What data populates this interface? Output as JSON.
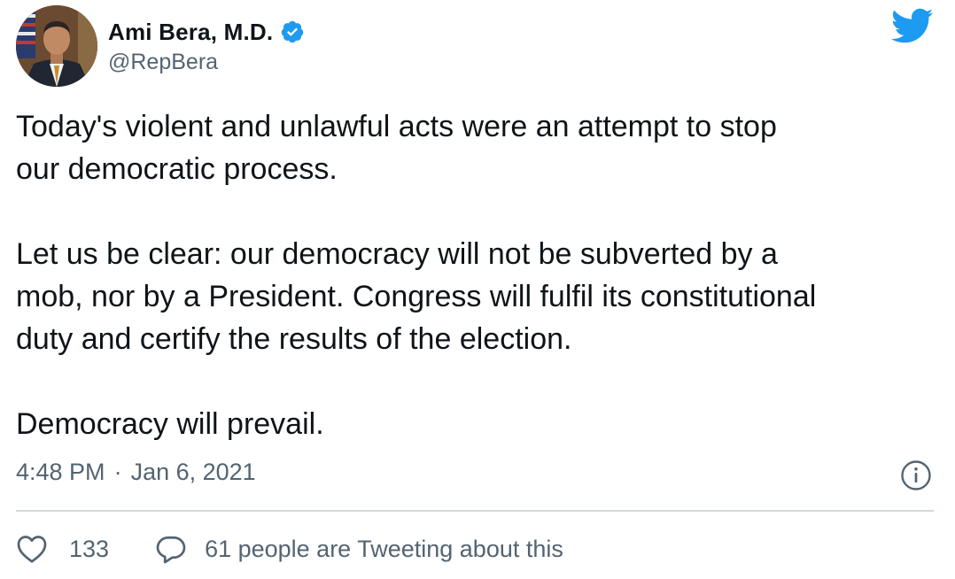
{
  "author": {
    "display_name": "Ami Bera, M.D.",
    "handle": "@RepBera",
    "verified": true
  },
  "tweet": {
    "paragraphs": [
      "Today's violent and unlawful acts were an attempt to stop\nour democratic process.",
      "Let us be clear: our democracy will not be subverted by a\nmob, nor by a President. Congress will fulfil its constitutional\nduty and certify the results of the election.",
      "Democracy will prevail."
    ],
    "time": "4:48 PM",
    "separator": "·",
    "date": "Jan 6, 2021"
  },
  "engagement": {
    "likes": "133",
    "tweeting_about": "61 people are Tweeting about this"
  },
  "icons": {
    "brand": "twitter-bird-icon",
    "verified": "verified-badge-icon",
    "info": "info-icon",
    "like": "heart-icon",
    "reply": "speech-bubble-icon"
  },
  "colors": {
    "brand_blue": "#1d9bf0",
    "text": "#0f1419",
    "muted": "#536471",
    "divider": "#cfd9de"
  }
}
